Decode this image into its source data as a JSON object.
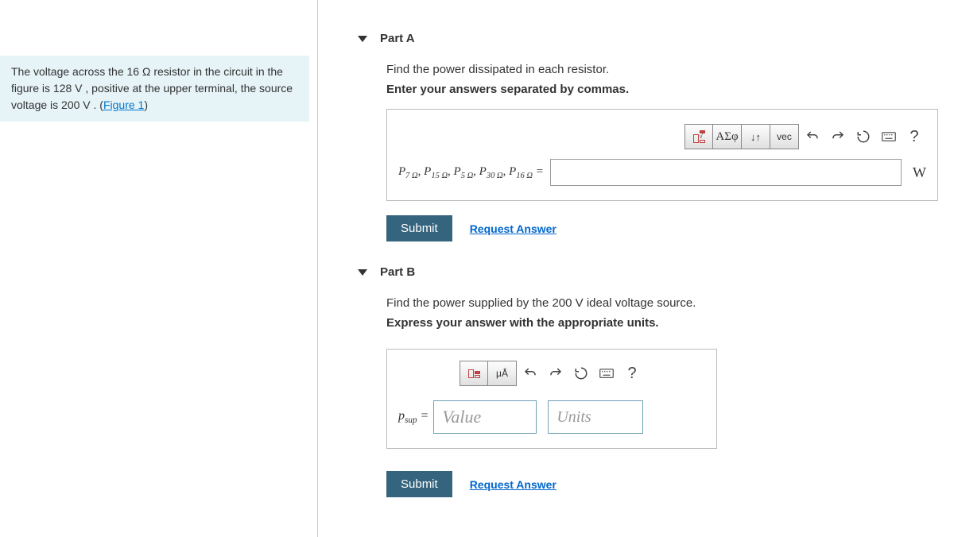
{
  "problem": {
    "text_before_figure": "The voltage across the 16 Ω resistor in the circuit in the figure is 128 V , positive at the upper terminal, the source voltage is 200 V . (",
    "figure_link": "Figure 1",
    "text_after": ")"
  },
  "partA": {
    "title": "Part A",
    "prompt1": "Find the power dissipated in each resistor.",
    "prompt2": "Enter your answers separated by commas.",
    "toolbar": {
      "template": "template",
      "greek": "ΑΣφ",
      "updown": "↓↑",
      "vec": "vec",
      "undo": "undo",
      "redo": "redo",
      "reset": "reset",
      "keyboard": "⌨",
      "help": "?"
    },
    "eq_label": "P7 Ω, P15 Ω, P5 Ω, P30 Ω, P16 Ω =",
    "unit": "W",
    "submit": "Submit",
    "request": "Request Answer"
  },
  "partB": {
    "title": "Part B",
    "prompt1": "Find the power supplied by the 200 V ideal voltage source.",
    "prompt2": "Express your answer with the appropriate units.",
    "toolbar": {
      "template": "template",
      "units": "μÅ",
      "undo": "undo",
      "redo": "redo",
      "reset": "reset",
      "keyboard": "⌨",
      "help": "?"
    },
    "eq_label": "psup =",
    "value_placeholder": "Value",
    "units_placeholder": "Units",
    "submit": "Submit",
    "request": "Request Answer"
  }
}
